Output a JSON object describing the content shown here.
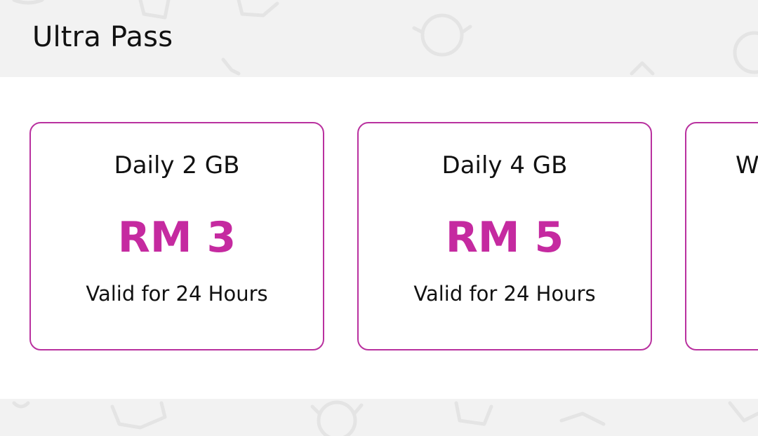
{
  "header": {
    "title": "Ultra Pass"
  },
  "passes": [
    {
      "name": "Daily 2 GB",
      "price": "RM 3",
      "validity": "Valid for 24 Hours"
    },
    {
      "name": "Daily 4 GB",
      "price": "RM 5",
      "validity": "Valid for 24 Hours"
    },
    {
      "name": "W",
      "price": "",
      "validity": ""
    }
  ],
  "colors": {
    "accent": "#c52aa0",
    "card_border": "#b9319f",
    "background": "#f2f2f2",
    "panel": "#ffffff",
    "text": "#111111"
  },
  "icons": [
    "background-doodle-icon"
  ]
}
